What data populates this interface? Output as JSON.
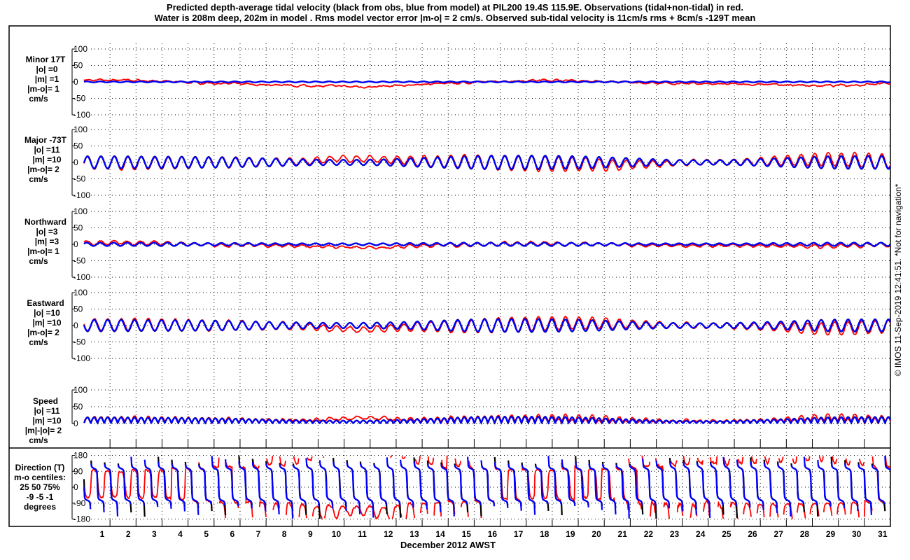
{
  "title_line1": "Predicted depth-average tidal velocity (black from obs, blue from model) at PIL200 19.4S 115.9E. Observations (tidal+non-tidal) in red.",
  "title_line2": "Water is 208m deep, 202m in model . Rms model vector error |m-o| = 2 cm/s. Observed sub-tidal velocity is 11cm/s rms + 8cm/s -129T mean",
  "side_note": "© IMOS 11-Sep-2019 12:41:51. *Not for navigation*",
  "colors": {
    "obs_tidal": "#000000",
    "model": "#0000ff",
    "observations": "#ff0000"
  },
  "chart_data": {
    "type": "line",
    "xlabel": "December 2012 AWST",
    "x_ticks": [
      "1",
      "2",
      "3",
      "4",
      "5",
      "6",
      "7",
      "8",
      "9",
      "10",
      "11",
      "12",
      "13",
      "14",
      "15",
      "16",
      "17",
      "18",
      "19",
      "20",
      "21",
      "22",
      "23",
      "24",
      "25",
      "26",
      "27",
      "28",
      "29",
      "30",
      "31"
    ],
    "xlim_days": [
      0,
      31
    ],
    "tidal_period_hours": 12.42,
    "grid": true,
    "panels": [
      {
        "key": "minor",
        "label": [
          "Minor 17T",
          "|o| =0",
          "|m| =1",
          "|m-o|= 1",
          "cm/s"
        ],
        "yticks": [
          "100",
          "50",
          "0",
          "-50",
          "-100"
        ],
        "ylim": [
          -100,
          100
        ],
        "model_amplitude": [
          1.5,
          1.5,
          1.5,
          1.5,
          1.5,
          1.5,
          1.5,
          1.5,
          1.5,
          1.5,
          1.5,
          1.5,
          1.5,
          1.5,
          1.5,
          1.5,
          1.5,
          1.5,
          1.5,
          1.5,
          1.5,
          1.5,
          1.5,
          1.5,
          1.5,
          1.5,
          1.5,
          1.5,
          1.5,
          1.5,
          1.5
        ],
        "obs_residual": [
          5,
          6,
          3,
          0,
          -3,
          -5,
          -8,
          -10,
          -12,
          -12,
          -15,
          -14,
          -10,
          -5,
          -3,
          0,
          3,
          5,
          5,
          2,
          0,
          -3,
          -5,
          -5,
          -6,
          -8,
          -8,
          -10,
          -12,
          -10,
          -5
        ]
      },
      {
        "key": "major",
        "label": [
          "Major -73T",
          "|o| =11",
          "|m| =10",
          "|m-o|= 2",
          "cm/s"
        ],
        "yticks": [
          "100",
          "50",
          "0",
          "-50",
          "-100"
        ],
        "ylim": [
          -100,
          100
        ],
        "model_amplitude": [
          18,
          18,
          17,
          17,
          16,
          15,
          13,
          11,
          9,
          8,
          8,
          9,
          12,
          15,
          18,
          20,
          20,
          20,
          19,
          17,
          14,
          11,
          8,
          7,
          7,
          9,
          12,
          15,
          18,
          19,
          19
        ],
        "obs_residual": [
          0,
          -3,
          -3,
          -3,
          0,
          0,
          0,
          0,
          3,
          10,
          12,
          10,
          5,
          3,
          5,
          0,
          -3,
          -5,
          -7,
          -7,
          -8,
          -5,
          -3,
          0,
          0,
          2,
          5,
          8,
          10,
          8,
          5
        ]
      },
      {
        "key": "north",
        "label": [
          "Northward",
          "|o| =3",
          "|m| =3",
          "|m-o|= 1",
          "cm/s"
        ],
        "yticks": [
          "100",
          "50",
          "0",
          "-50",
          "-100"
        ],
        "ylim": [
          -100,
          100
        ],
        "model_amplitude": [
          5,
          5,
          5,
          5,
          4,
          4,
          4,
          3,
          3,
          3,
          3,
          3,
          4,
          4,
          5,
          5,
          5,
          5,
          5,
          4,
          4,
          3,
          3,
          3,
          3,
          3,
          4,
          4,
          5,
          5,
          5
        ],
        "obs_residual": [
          4,
          6,
          4,
          2,
          0,
          -2,
          -3,
          -4,
          -6,
          -8,
          -10,
          -10,
          -6,
          -3,
          -2,
          0,
          2,
          2,
          2,
          0,
          -2,
          -3,
          -3,
          -3,
          -4,
          -5,
          -5,
          -6,
          -6,
          -4,
          -2
        ]
      },
      {
        "key": "east",
        "label": [
          "Eastward",
          "|o| =10",
          "|m| =10",
          "|m-o|= 2",
          "cm/s"
        ],
        "yticks": [
          "100",
          "50",
          "0",
          "-50",
          "-100"
        ],
        "ylim": [
          -100,
          100
        ],
        "model_amplitude": [
          17,
          17,
          16,
          16,
          15,
          14,
          12,
          10,
          9,
          8,
          8,
          9,
          11,
          14,
          17,
          19,
          19,
          19,
          18,
          16,
          13,
          10,
          8,
          7,
          7,
          9,
          11,
          14,
          17,
          18,
          18
        ],
        "obs_residual": [
          2,
          3,
          3,
          2,
          0,
          0,
          0,
          0,
          -3,
          -10,
          -12,
          -10,
          -5,
          -3,
          -5,
          0,
          3,
          5,
          7,
          7,
          6,
          4,
          2,
          0,
          0,
          -2,
          -5,
          -8,
          -10,
          -8,
          -5
        ]
      },
      {
        "key": "speed",
        "label": [
          "Speed",
          "|o| =11",
          "|m| =10",
          "|m|-|o|= 2",
          "cm/s"
        ],
        "yticks": [
          "100",
          "50",
          "0"
        ],
        "ylim": [
          0,
          100
        ]
      }
    ],
    "direction_panel": {
      "label": [
        "Direction (T)",
        "m-o centiles:",
        "25  50  75%",
        "-9 -5 -1",
        "degrees"
      ],
      "yticks": [
        "180",
        "90",
        "0",
        "-90",
        "-180"
      ],
      "ylim": [
        -180,
        180
      ]
    }
  }
}
